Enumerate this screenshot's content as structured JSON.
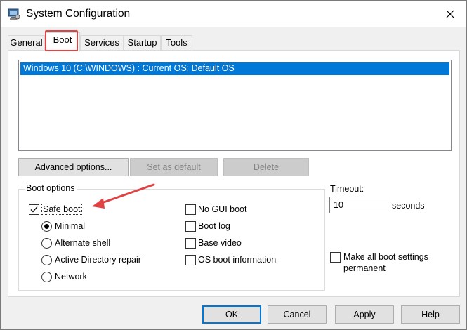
{
  "window": {
    "title": "System Configuration",
    "close_glyph": "✕"
  },
  "tabs": [
    {
      "label": "General",
      "active": false
    },
    {
      "label": "Boot",
      "active": true
    },
    {
      "label": "Services",
      "active": false
    },
    {
      "label": "Startup",
      "active": false
    },
    {
      "label": "Tools",
      "active": false
    }
  ],
  "boot_list": {
    "items": [
      "Windows 10 (C:\\WINDOWS) : Current OS; Default OS"
    ],
    "selected_index": 0
  },
  "list_buttons": {
    "advanced": "Advanced options...",
    "set_default": "Set as default",
    "delete": "Delete"
  },
  "boot_options": {
    "legend": "Boot options",
    "safe_boot": {
      "label": "Safe boot",
      "checked": true
    },
    "safe_boot_modes": [
      {
        "label": "Minimal",
        "checked": true
      },
      {
        "label": "Alternate shell",
        "checked": false
      },
      {
        "label": "Active Directory repair",
        "checked": false
      },
      {
        "label": "Network",
        "checked": false
      }
    ],
    "no_gui_boot": {
      "label": "No GUI boot",
      "checked": false
    },
    "boot_log": {
      "label": "Boot log",
      "checked": false
    },
    "base_video": {
      "label": "Base video",
      "checked": false
    },
    "os_boot_info": {
      "label": "OS boot information",
      "checked": false
    }
  },
  "timeout": {
    "label": "Timeout:",
    "value": "10",
    "unit": "seconds"
  },
  "make_permanent": {
    "line1": "Make all boot settings",
    "line2": "permanent",
    "checked": false
  },
  "dialog_buttons": {
    "ok": "OK",
    "cancel": "Cancel",
    "apply": "Apply",
    "help": "Help"
  },
  "colors": {
    "selection": "#0078d7",
    "annotation": "#e04343"
  },
  "icons": {
    "app": "system-config-icon",
    "close": "close-icon",
    "checkmark": "checkmark-icon",
    "arrow": "annotation-arrow-icon"
  }
}
